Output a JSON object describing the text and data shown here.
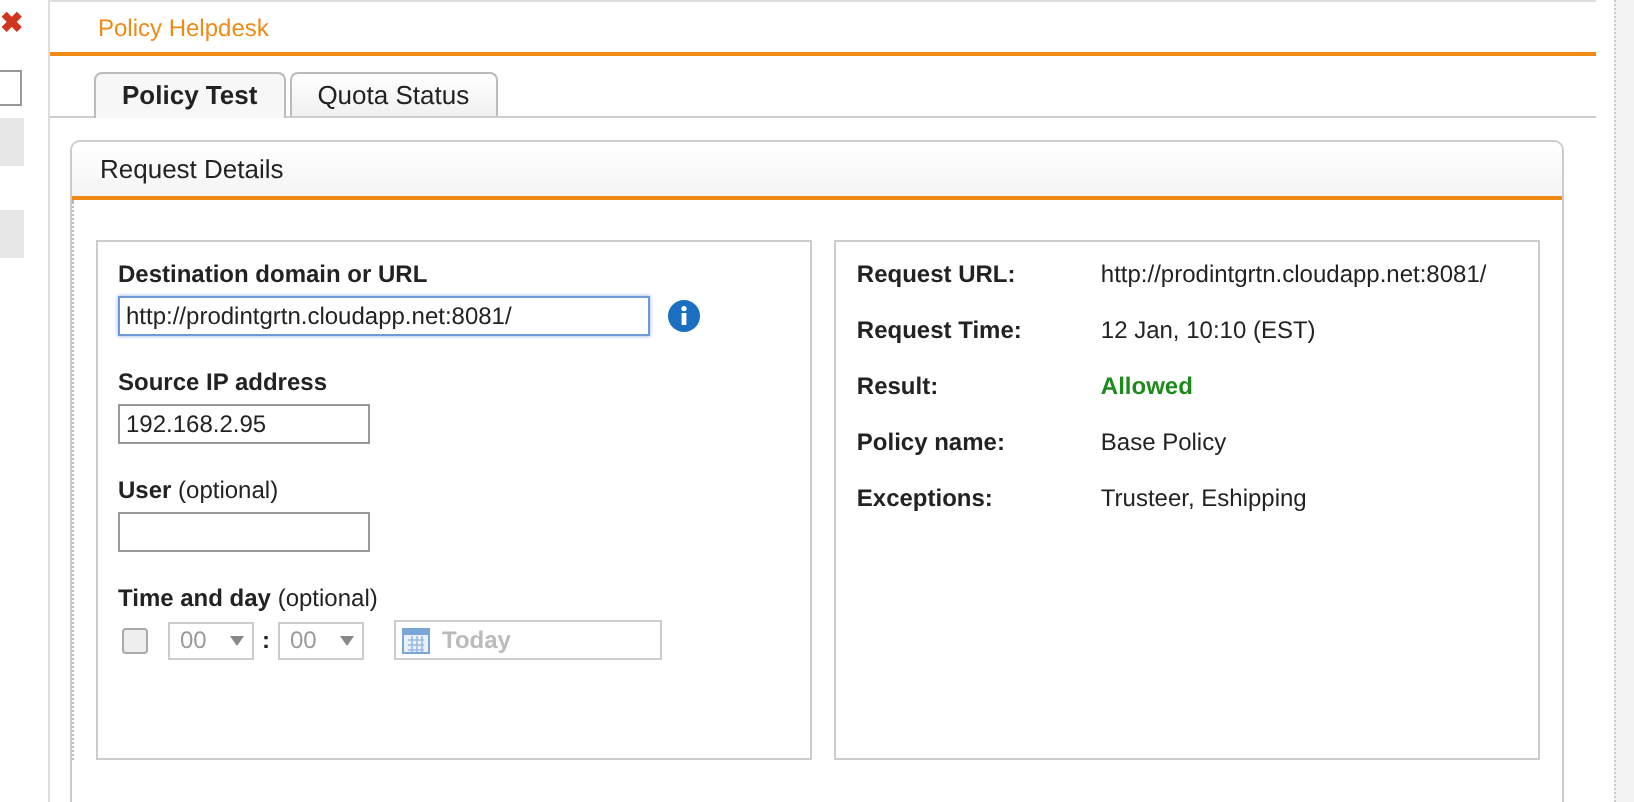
{
  "sidebar": {
    "close_icon": "✖"
  },
  "window": {
    "title": "Policy Helpdesk"
  },
  "tabs": [
    {
      "label": "Policy Test",
      "selected": true
    },
    {
      "label": "Quota Status",
      "selected": false
    }
  ],
  "panel": {
    "title": "Request Details"
  },
  "form": {
    "fields": [
      {
        "kind": "text",
        "label": "Destination domain or URL",
        "value": "http://prodintgrtn.cloudapp.net:8081/",
        "focused": true,
        "info": true
      },
      {
        "kind": "text",
        "label": "Source IP address",
        "value": "192.168.2.95",
        "focused": false
      },
      {
        "kind": "text",
        "label": "User",
        "hint": "(optional)",
        "focused": false
      },
      {
        "kind": "time",
        "label": "Time and day",
        "hint": "(optional)",
        "checked": false,
        "disabled": true,
        "hour": "00",
        "separator": ":",
        "minute": "00",
        "date_placeholder": "Today"
      }
    ]
  },
  "result": {
    "rows": [
      {
        "label": "Request URL:",
        "value": "http://prodintgrtn.cloudapp.net:8081/",
        "color": "#222222"
      },
      {
        "label": "Request Time:",
        "value": "12 Jan, 10:10 (EST)",
        "color": "#222222"
      },
      {
        "label": "Result:",
        "value": "Allowed",
        "color": "#1e8a1e"
      },
      {
        "label": "Policy name:",
        "value": "Base Policy",
        "color": "#222222"
      },
      {
        "label": "Exceptions:",
        "value": "Trusteer, Eshipping",
        "color": "#222222"
      }
    ]
  }
}
